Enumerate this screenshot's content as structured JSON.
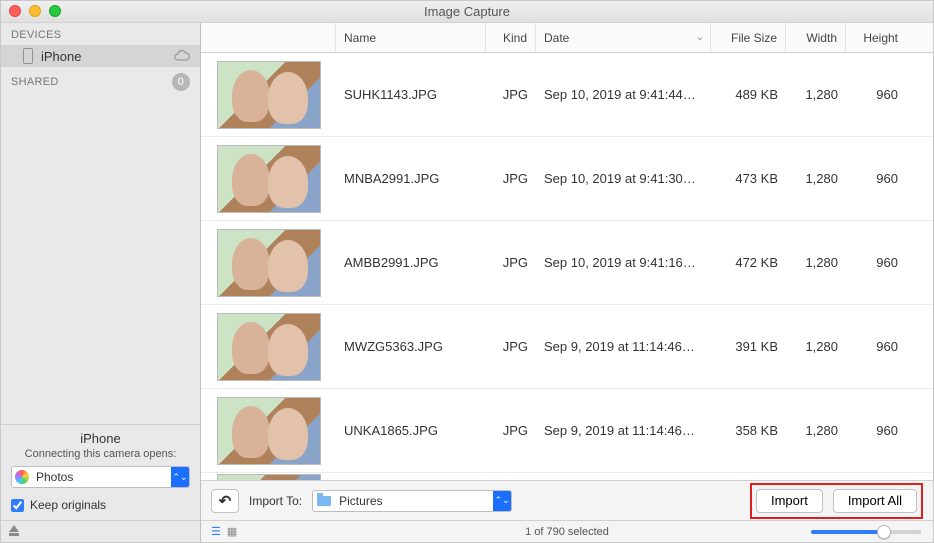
{
  "window": {
    "title": "Image Capture"
  },
  "sidebar": {
    "devices_header": "DEVICES",
    "device_name": "iPhone",
    "shared_header": "SHARED",
    "shared_count": "0",
    "selected_device_title": "iPhone",
    "opens_label": "Connecting this camera opens:",
    "opens_value": "Photos",
    "keep_originals_label": "Keep originals"
  },
  "columns": {
    "name": "Name",
    "kind": "Kind",
    "date": "Date",
    "filesize": "File Size",
    "width": "Width",
    "height": "Height"
  },
  "rows": [
    {
      "name": "SUHK1143.JPG",
      "kind": "JPG",
      "date": "Sep 10, 2019 at 9:41:44…",
      "filesize": "489 KB",
      "width": "1,280",
      "height": "960"
    },
    {
      "name": "MNBA2991.JPG",
      "kind": "JPG",
      "date": "Sep 10, 2019 at 9:41:30…",
      "filesize": "473 KB",
      "width": "1,280",
      "height": "960"
    },
    {
      "name": "AMBB2991.JPG",
      "kind": "JPG",
      "date": "Sep 10, 2019 at 9:41:16…",
      "filesize": "472 KB",
      "width": "1,280",
      "height": "960"
    },
    {
      "name": "MWZG5363.JPG",
      "kind": "JPG",
      "date": "Sep 9, 2019 at 11:14:46…",
      "filesize": "391 KB",
      "width": "1,280",
      "height": "960"
    },
    {
      "name": "UNKA1865.JPG",
      "kind": "JPG",
      "date": "Sep 9, 2019 at 11:14:46…",
      "filesize": "358 KB",
      "width": "1,280",
      "height": "960"
    }
  ],
  "toolbar": {
    "import_to_label": "Import To:",
    "import_to_value": "Pictures",
    "import_label": "Import",
    "import_all_label": "Import All"
  },
  "status": {
    "selection": "1 of 790 selected"
  }
}
